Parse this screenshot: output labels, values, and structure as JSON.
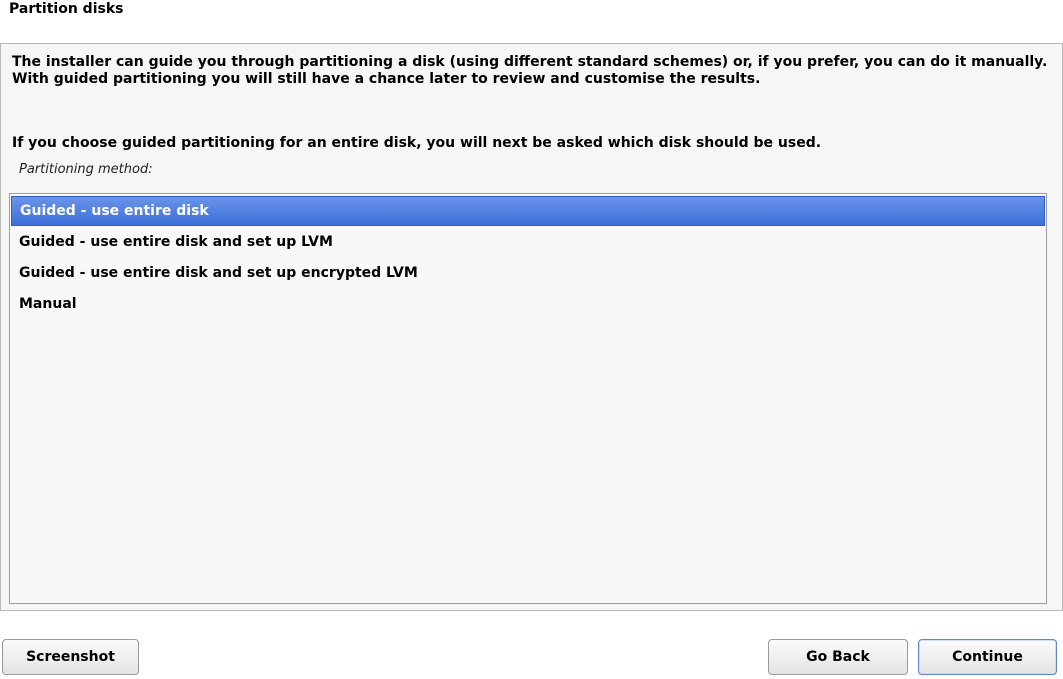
{
  "header": {
    "title": "Partition disks"
  },
  "main": {
    "intro_text": "The installer can guide you through partitioning a disk (using different standard schemes) or, if you prefer, you can do it manually. With guided partitioning you will still have a chance later to review and customise the results.",
    "question_text": "If you choose guided partitioning for an entire disk, you will next be asked which disk should be used.",
    "list_label": "Partitioning method:",
    "options": [
      {
        "label": "Guided - use entire disk",
        "selected": true
      },
      {
        "label": "Guided - use entire disk and set up LVM",
        "selected": false
      },
      {
        "label": "Guided - use entire disk and set up encrypted LVM",
        "selected": false
      },
      {
        "label": "Manual",
        "selected": false
      }
    ]
  },
  "footer": {
    "screenshot_label": "Screenshot",
    "back_label": "Go Back",
    "continue_label": "Continue"
  },
  "colors": {
    "selection": "#4a7ee0",
    "panel_background": "#f6f6f6",
    "border": "#b8b8b8"
  }
}
